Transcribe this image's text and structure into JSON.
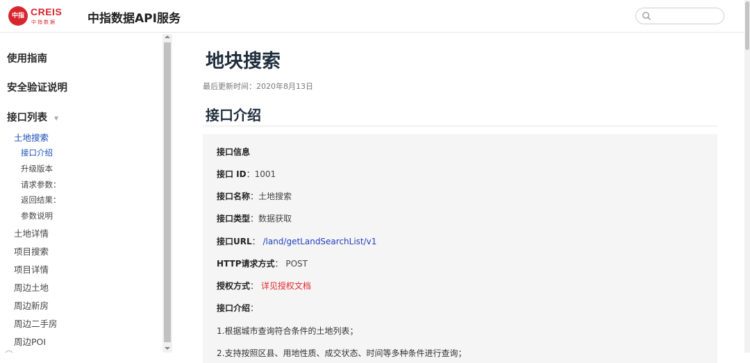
{
  "header": {
    "logo_badge": "中指",
    "logo_en": "CREIS",
    "logo_cn": "中指数据",
    "site_title": "中指数据API服务",
    "search_placeholder": ""
  },
  "sidebar": {
    "top_items": [
      "使用指南",
      "安全验证说明",
      "接口列表"
    ],
    "caret": "▼",
    "land_search": "土地搜索",
    "sub_items": [
      "接口介绍",
      "升级版本",
      "请求参数：",
      "返回结果：",
      "参数说明"
    ],
    "other_items": [
      "土地详情",
      "项目搜索",
      "项目详情",
      "周边土地",
      "周边新房",
      "周边二手房",
      "周边POI"
    ]
  },
  "main": {
    "title": "地块搜索",
    "updated": "最后更新时间：2020年8月13日",
    "section": "接口介绍",
    "info": {
      "heading": "接口信息",
      "id_label": "接口 ID",
      "id_value": "1001",
      "name_label": "接口名称",
      "name_value": "土地搜索",
      "type_label": "接口类型",
      "type_value": "数据获取",
      "url_label": "接口URL",
      "url_value": "/land/getLandSearchList/v1",
      "method_label": "HTTP请求方式",
      "method_value": "POST",
      "auth_label": "授权方式",
      "auth_value": "详见授权文档",
      "intro_label": "接口介绍",
      "intro_1": "1.根据城市查询符合条件的土地列表；",
      "intro_2": "2.支持按照区县、用地性质、成交状态、时间等多种条件进行查询；"
    }
  },
  "colors": {
    "brand_red": "#d8262f",
    "link_blue": "#1f3fbf",
    "active_nav": "#1a4fb8",
    "panel_bg": "#f5f5f5"
  }
}
